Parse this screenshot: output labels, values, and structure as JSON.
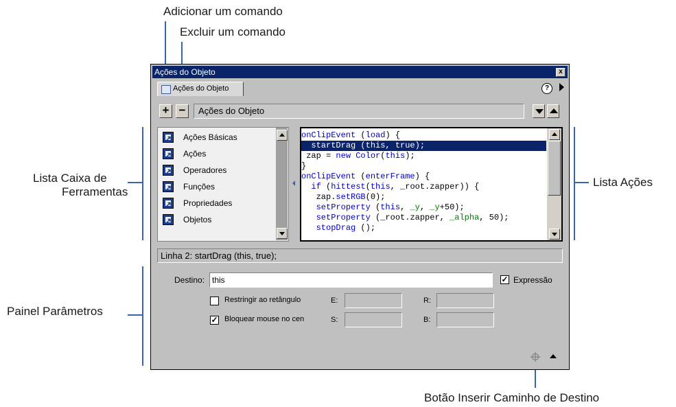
{
  "callouts": {
    "add": "Adicionar um comando",
    "remove": "Excluir um comando",
    "toolbox_line1": "Lista Caixa de",
    "toolbox_line2": "Ferramentas",
    "actions_list": "Lista Ações",
    "params": "Painel Parâmetros",
    "target_path": "Botão Inserir Caminho de Destino"
  },
  "window": {
    "title": "Ações do Objeto",
    "close_label": "x",
    "tab_label": "Ações do Objeto",
    "help_label": "?"
  },
  "toolbar": {
    "add_label": "+",
    "remove_label": "−",
    "combo_value": "Ações do Objeto"
  },
  "toolbox": {
    "items": [
      {
        "label": "Ações Básicas",
        "icon": "book-icon"
      },
      {
        "label": "Ações",
        "icon": "book-icon"
      },
      {
        "label": "Operadores",
        "icon": "book-icon"
      },
      {
        "label": "Funções",
        "icon": "book-icon"
      },
      {
        "label": "Propriedades",
        "icon": "book-icon"
      },
      {
        "label": "Objetos",
        "icon": "book-icon"
      }
    ]
  },
  "code_lines": [
    "onClipEvent (load) {",
    " startDrag (this, true);",
    " zap = new Color(this);",
    "}",
    "onClipEvent (enterFrame) {",
    " if (hittest(this, _root.zapper)) {",
    "  zap.setRGB(0);",
    "  setProperty (this, _y, _y+50);",
    "  setProperty (_root.zapper, _alpha, 50);",
    "  stopDrag ();"
  ],
  "selected_line": 2,
  "status_text": "Linha 2: startDrag (this, true);",
  "params": {
    "target_label": "Destino:",
    "target_value": "this",
    "expression_label": "Expressão",
    "expression_checked": true,
    "constrain_label": "Restringir ao retângulo",
    "constrain_checked": false,
    "lock_label": "Bloquear mouse no cen",
    "lock_checked": true,
    "l_label": "E:",
    "r_label": "R:",
    "t_label": "S:",
    "b_label": "B:"
  },
  "colors": {
    "selection": "#0a246a",
    "keyword": "#0000c8",
    "variable": "#008000",
    "callout_line": "#3a63a8"
  }
}
